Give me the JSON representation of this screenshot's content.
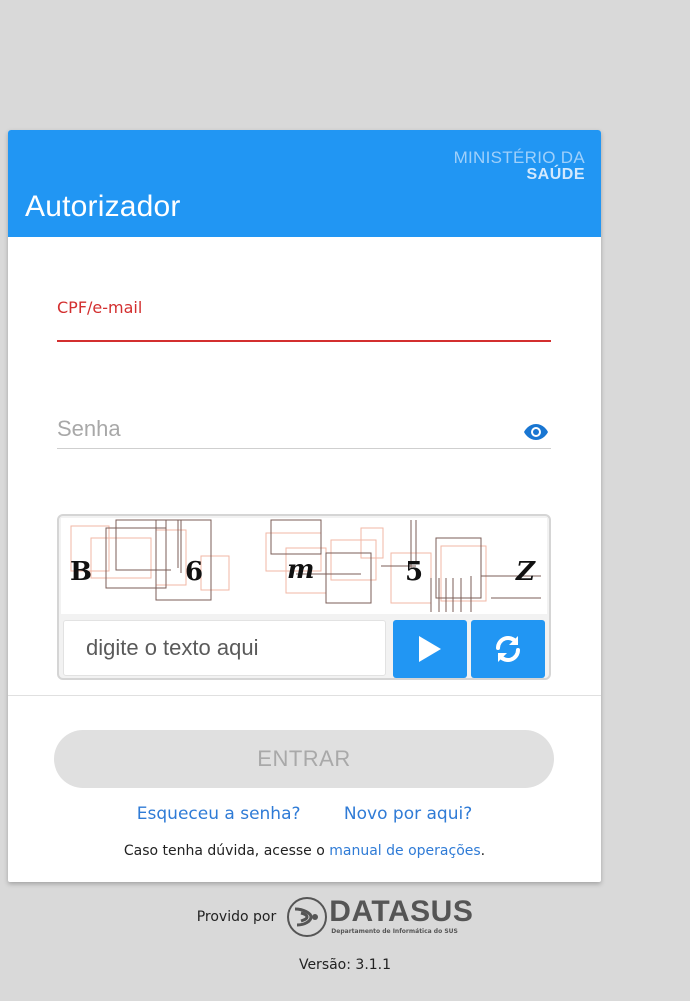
{
  "header": {
    "app_title": "Autorizador",
    "ministry_line1": "MINISTÉRIO DA",
    "ministry_line2": "SAÚDE"
  },
  "login_form": {
    "cpf_label": "CPF/e-mail",
    "cpf_value": "",
    "password_label": "Senha",
    "password_value": "",
    "show_password_icon": "eye-icon"
  },
  "captcha": {
    "characters": [
      "B",
      "6",
      "m",
      "5",
      "Z"
    ],
    "input_placeholder": "digite o texto aqui",
    "input_value": "",
    "play_icon": "play-icon",
    "refresh_icon": "refresh-icon"
  },
  "actions": {
    "login_label": "ENTRAR",
    "forgot_password": "Esqueceu a senha?",
    "new_user": "Novo por aqui?",
    "help_prefix": "Caso tenha dúvida, acesse o ",
    "help_link": "manual de operações",
    "help_suffix": "."
  },
  "footer": {
    "provided_by": "Provido por",
    "logo_name": "DATASUS",
    "logo_subtitle": "Departamento de Informática do SUS",
    "version": "Versão: 3.1.1"
  },
  "colors": {
    "primary": "#2196f3",
    "error": "#d32f2f",
    "link": "#2f7bd6",
    "background": "#d9d9d9"
  }
}
